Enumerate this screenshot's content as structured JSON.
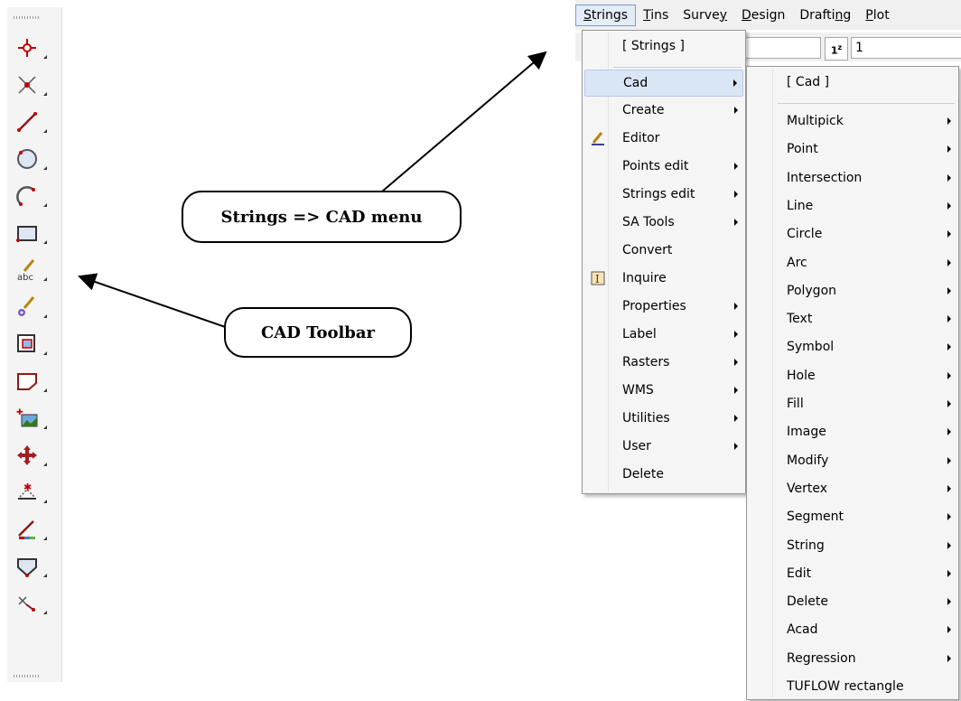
{
  "toolbar": {
    "tools": [
      "point-tool-icon",
      "intersection-tool-icon",
      "line-tool-icon",
      "circle-tool-icon",
      "arc-tool-icon",
      "polygon-tool-icon",
      "text-tool-icon",
      "symbol-tool-icon",
      "hole-tool-icon",
      "fill-tool-icon",
      "image-tool-icon",
      "modify-move-tool-icon",
      "vertex-tool-icon",
      "segment-tool-icon",
      "string-tool-icon",
      "delete-tool-icon"
    ]
  },
  "callouts": {
    "cad_menu": "Strings => CAD menu",
    "cad_toolbar": "CAD Toolbar"
  },
  "menubar": {
    "items": [
      "Strings",
      "Tins",
      "Survey",
      "Design",
      "Drafting",
      "Plot"
    ],
    "mnemonics": [
      "S",
      "T",
      "y",
      "D",
      "n",
      "P"
    ],
    "active": "Strings"
  },
  "toolrow": {
    "field_value": "1"
  },
  "strings_menu": {
    "header": "[ Strings ]",
    "items": [
      {
        "label": "Cad",
        "submenu": true,
        "highlighted": true
      },
      {
        "label": "Create",
        "submenu": true
      },
      {
        "label": "Editor",
        "submenu": false,
        "icon": "editor-pencil-icon"
      },
      {
        "label": "Points edit",
        "submenu": true
      },
      {
        "label": "Strings edit",
        "submenu": true
      },
      {
        "label": "SA Tools",
        "submenu": true
      },
      {
        "label": "Convert",
        "submenu": false
      },
      {
        "label": "Inquire",
        "submenu": false,
        "icon": "inquire-icon"
      },
      {
        "label": "Properties",
        "submenu": true
      },
      {
        "label": "Label",
        "submenu": true
      },
      {
        "label": "Rasters",
        "submenu": true
      },
      {
        "label": "WMS",
        "submenu": true
      },
      {
        "label": "Utilities",
        "submenu": true
      },
      {
        "label": "User",
        "submenu": true
      },
      {
        "label": "Delete",
        "submenu": false
      }
    ]
  },
  "cad_menu": {
    "header": "[ Cad ]",
    "items": [
      "Multipick",
      "Point",
      "Intersection",
      "Line",
      "Circle",
      "Arc",
      "Polygon",
      "Text",
      "Symbol",
      "Hole",
      "Fill",
      "Image",
      "Modify",
      "Vertex",
      "Segment",
      "String",
      "Edit",
      "Delete",
      "Acad",
      "Regression",
      "TUFLOW rectangle"
    ],
    "last_without_submenu": "TUFLOW rectangle"
  },
  "colors": {
    "menu_bg": "#f5f5f5",
    "highlight": "#dae6f5",
    "highlight_border": "#b3cbea",
    "toolbar_bg": "#f4f4f4"
  }
}
